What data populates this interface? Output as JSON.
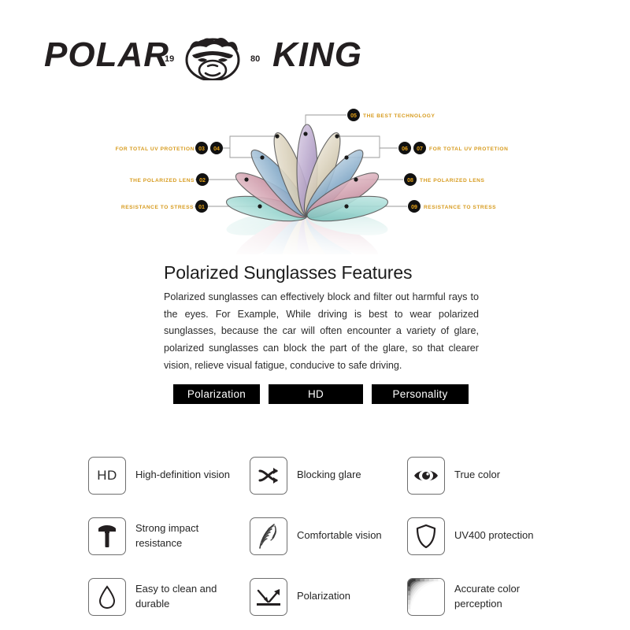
{
  "brand": {
    "name_left": "POLAR",
    "name_right": "KING",
    "year_left": "19",
    "year_right": "80",
    "emblem": "gorilla-face-emblem"
  },
  "diagram": {
    "title": "exploded-lens-fan",
    "badge_color": "#111111",
    "badge_text_color": "#e8a317",
    "label_color": "#d79b1e",
    "connector_color": "#8d8d8d",
    "left_callouts": [
      {
        "number": "03",
        "label": "FOR TOTAL UV PROTETION",
        "second_number": "04"
      },
      {
        "number": "02",
        "label": "THE POLARIZED LENS"
      },
      {
        "number": "01",
        "label": "RESISTANCE TO STRESS"
      }
    ],
    "right_callouts": [
      {
        "number": "05",
        "label": "THE BEST TECHNOLOGY"
      },
      {
        "number": "06",
        "second_number": "07",
        "label": "FOR TOTAL UV PROTETION"
      },
      {
        "number": "08",
        "label": "THE POLARIZED LENS"
      },
      {
        "number": "09",
        "label": "RESISTANCE TO STRESS"
      }
    ],
    "petal_colors": [
      "#a8ddd8",
      "#d9a8b4",
      "#8fb3cd",
      "#d9d3c0",
      "#b9a8cb",
      "#d9d0bc",
      "#8fb0cc",
      "#d4a3b2",
      "#9fd8d3"
    ]
  },
  "copy": {
    "title": "Polarized Sunglasses Features",
    "paragraph": "Polarized sunglasses can effectively block and filter out harmful rays to the eyes. For Example, While driving is best to wear polarized sunglasses, because the car will often encounter a variety of glare, polarized sunglasses can block the part of the glare, so that clearer vision, relieve visual fatigue, conducive to safe driving."
  },
  "tabs": [
    {
      "label": "Polarization"
    },
    {
      "label": "HD"
    },
    {
      "label": "Personality"
    }
  ],
  "features": [
    {
      "icon": "hd-icon",
      "icon_text": "HD",
      "label": "High-definition vision"
    },
    {
      "icon": "crossed-arrows-icon",
      "label": "Blocking glare"
    },
    {
      "icon": "eye-icon",
      "label": "True color"
    },
    {
      "icon": "hammer-icon",
      "label": "Strong impact resistance"
    },
    {
      "icon": "feather-icon",
      "label": "Comfortable vision"
    },
    {
      "icon": "shield-icon",
      "label": "UV400 protection"
    },
    {
      "icon": "water-drop-icon",
      "label": "Easy to clean and durable"
    },
    {
      "icon": "light-reflection-icon",
      "label": "Polarization"
    },
    {
      "icon": "color-arc-icon",
      "label": "Accurate color perception"
    }
  ]
}
